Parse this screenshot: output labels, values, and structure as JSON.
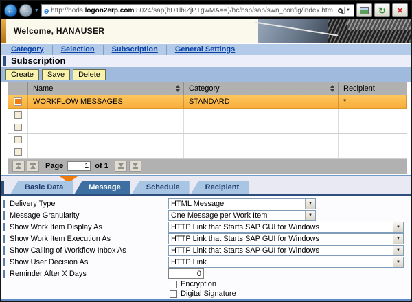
{
  "icons": {
    "back": "←",
    "forward": "→",
    "history_dropdown": "▼",
    "ie_logo": "e",
    "search_dropdown": "▼",
    "refresh": "↻",
    "stop": "×",
    "select_arrow": "▼"
  },
  "browser": {
    "url_prefix": "http://bods.",
    "url_domain": "logon2erp.com",
    "url_suffix": ":8024/sap(bD1lbiZjPTgwMA==)/bc/bsp/sap/swn_config/index.htm"
  },
  "header": {
    "welcome_text": "Welcome, HANAUSER"
  },
  "nav": {
    "category": "Category",
    "selection": "Selection",
    "subscription": "Subscription",
    "general_settings": "General Settings"
  },
  "page_title": "Subscription",
  "toolbar": {
    "create": "Create",
    "save": "Save",
    "delete": "Delete"
  },
  "table": {
    "columns": {
      "name": "Name",
      "category": "Category",
      "recipient": "Recipient"
    },
    "selected_row": {
      "name": "WORKFLOW MESSAGES",
      "category": "STANDARD",
      "recipient": "*"
    },
    "empty_row_count": 4,
    "pagination": {
      "page_label": "Page",
      "current_page": "1",
      "of_label": "of 1"
    }
  },
  "tabs": {
    "basic_data": "Basic Data",
    "message": "Message",
    "schedule": "Schedule",
    "recipient": "Recipient",
    "active_tab": "Message"
  },
  "form": {
    "fields": [
      {
        "label": "Delivery Type",
        "value": "HTML Message"
      },
      {
        "label": "Message Granularity",
        "value": "One Message per Work Item"
      },
      {
        "label": "Show Work Item Display As",
        "value": "HTTP Link that Starts SAP GUI for Windows"
      },
      {
        "label": "Show Work Item Execution As",
        "value": "HTTP Link that Starts SAP GUI for Windows"
      },
      {
        "label": "Show Calling of Workflow Inbox As",
        "value": "HTTP Link that Starts SAP GUI for Windows"
      },
      {
        "label": "Show User Decision As",
        "value": "HTTP Link"
      },
      {
        "label": "Reminder After X Days",
        "value": "0"
      }
    ],
    "checkboxes": [
      {
        "label": "Encryption",
        "checked": false
      },
      {
        "label": "Digital Signature",
        "checked": false
      }
    ]
  },
  "colors": {
    "accent_orange": "#F07B0A",
    "selected_row_top": "#FDC75F",
    "selected_row_bottom": "#F9AD39",
    "selected_checkbox": "#F27B0C",
    "tab_active_blue": "#3E6FA3",
    "toolbar_blue": "#9FBADC",
    "nav_bar_blue": "#B3CBE8",
    "button_yellow": "#F8F2AD",
    "link_blue": "#0A43A5",
    "table_header_gray": "#B1B1B1",
    "header_orange_bar": "#D89A30"
  }
}
